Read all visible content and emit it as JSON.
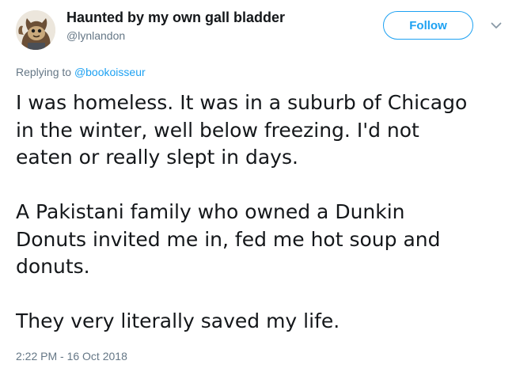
{
  "author": {
    "display_name": "Haunted by my own gall bladder",
    "handle": "@lynlandon"
  },
  "actions": {
    "follow_label": "Follow",
    "more_icon": "chevron-down-icon"
  },
  "reply": {
    "prefix": "Replying to",
    "mention": "@bookoisseur"
  },
  "tweet": {
    "lines": [
      "I was homeless. It was in a suburb of Chicago",
      "in the winter, well below freezing. I'd not",
      "eaten or really slept in days.",
      "A Pakistani family who owned a Dunkin",
      "Donuts invited me in, fed me hot soup and",
      "donuts.",
      "They very literally saved my life."
    ],
    "timestamp": "2:22 PM - 16 Oct 2018"
  },
  "colors": {
    "accent": "#1da1f2",
    "text": "#14171a",
    "muted": "#657786"
  }
}
